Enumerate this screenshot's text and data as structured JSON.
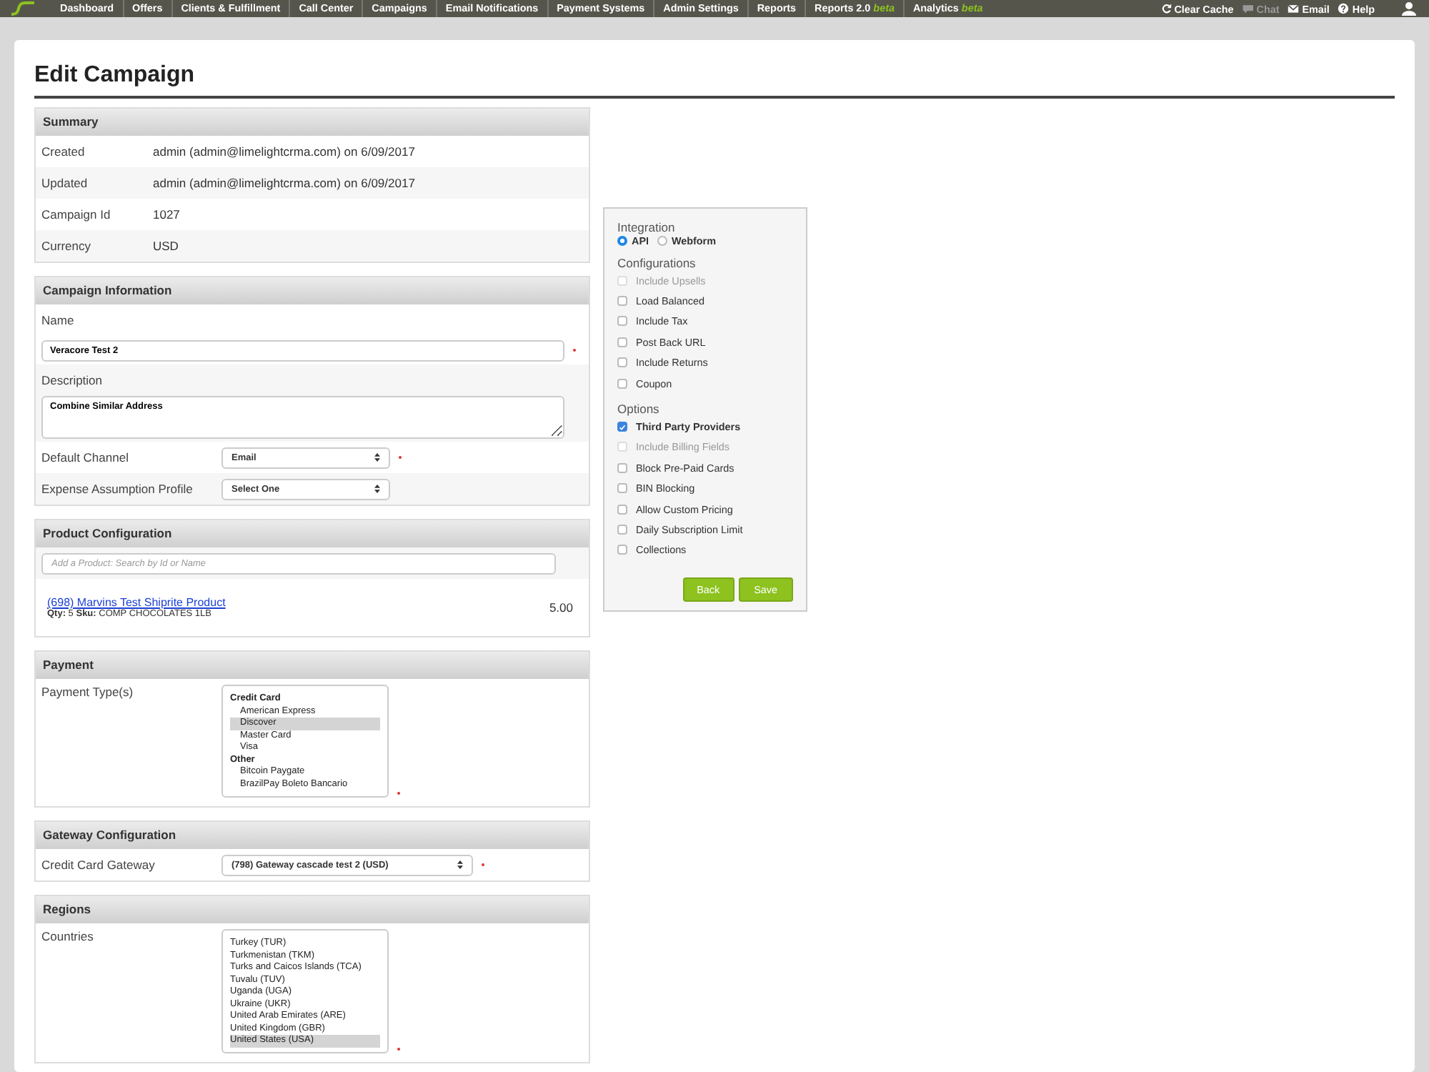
{
  "nav": {
    "items": [
      {
        "label": "Dashboard"
      },
      {
        "label": "Offers"
      },
      {
        "label": "Clients & Fulfillment"
      },
      {
        "label": "Call Center"
      },
      {
        "label": "Campaigns"
      },
      {
        "label": "Email Notifications"
      },
      {
        "label": "Payment Systems"
      },
      {
        "label": "Admin Settings"
      },
      {
        "label": "Reports"
      },
      {
        "label": "Reports 2.0",
        "tag": "beta"
      },
      {
        "label": "Analytics",
        "tag": "beta"
      }
    ],
    "tools": [
      {
        "label": "Clear Cache",
        "kind": "refresh",
        "disabled": false
      },
      {
        "label": "Chat",
        "kind": "chat",
        "disabled": true
      },
      {
        "label": "Email",
        "kind": "mail",
        "disabled": false
      },
      {
        "label": "Help",
        "kind": "help",
        "disabled": false
      }
    ]
  },
  "page_title": "Edit Campaign",
  "sections": [
    {
      "title": "Summary",
      "rows": [
        {
          "kind": "info",
          "label": "Created",
          "value": "admin (admin@limelightcrma.com) on 6/09/2017"
        },
        {
          "kind": "info",
          "label": "Updated",
          "value": "admin (admin@limelightcrma.com) on 6/09/2017"
        },
        {
          "kind": "info",
          "label": "Campaign Id",
          "value": "1027"
        },
        {
          "kind": "info",
          "label": "Currency",
          "value": "USD"
        }
      ]
    },
    {
      "title": "Campaign Information",
      "rows": [
        {
          "kind": "input",
          "label": "Name",
          "value": "Veracore Test 2",
          "required": true
        },
        {
          "kind": "textarea",
          "label": "Description",
          "value": "Combine Similar Address",
          "required": false
        },
        {
          "kind": "select",
          "label": "Default Channel",
          "value": "Email",
          "required": true
        },
        {
          "kind": "select",
          "label": "Expense Assumption Profile",
          "value": "Select One",
          "required": false
        }
      ]
    },
    {
      "title": "Product Configuration",
      "rows": [
        {
          "kind": "search",
          "placeholder": "Add a Product: Search by Id or Name"
        },
        {
          "kind": "product",
          "link": "(698) Marvins Test Shiprite Product",
          "detail": "**Qty:** 5 **Sku:** COMP CHOCOLATES 1LB",
          "price": "5.00"
        }
      ]
    },
    {
      "title": "Payment",
      "rows": [
        {
          "kind": "listbox",
          "label": "Payment Type(s)",
          "required": true,
          "options": [
            {
              "kind": "group",
              "label": "Credit Card"
            },
            {
              "kind": "option",
              "label": "American Express",
              "selected": false
            },
            {
              "kind": "option",
              "label": "Discover",
              "selected": true
            },
            {
              "kind": "option",
              "label": "Master Card",
              "selected": false
            },
            {
              "kind": "option",
              "label": "Visa",
              "selected": false
            },
            {
              "kind": "group",
              "label": "Other"
            },
            {
              "kind": "option",
              "label": "Bitcoin Paygate",
              "selected": false
            },
            {
              "kind": "option",
              "label": "BrazilPay Boleto Bancario",
              "selected": false
            }
          ]
        }
      ]
    },
    {
      "title": "Gateway Configuration",
      "rows": [
        {
          "kind": "select",
          "label": "Credit Card Gateway",
          "value": "(798) Gateway cascade test 2 (USD)",
          "required": true
        }
      ]
    },
    {
      "title": "Regions",
      "rows": [
        {
          "kind": "listbox",
          "label": "Countries",
          "required": true,
          "options": [
            {
              "kind": "option",
              "label": "Turkey (TUR)",
              "selected": false
            },
            {
              "kind": "option",
              "label": "Turkmenistan (TKM)",
              "selected": false
            },
            {
              "kind": "option",
              "label": "Turks and Caicos Islands (TCA)",
              "selected": false
            },
            {
              "kind": "option",
              "label": "Tuvalu (TUV)",
              "selected": false
            },
            {
              "kind": "option",
              "label": "Uganda (UGA)",
              "selected": false
            },
            {
              "kind": "option",
              "label": "Ukraine (UKR)",
              "selected": false
            },
            {
              "kind": "option",
              "label": "United Arab Emirates (ARE)",
              "selected": false
            },
            {
              "kind": "option",
              "label": "United Kingdom (GBR)",
              "selected": false
            },
            {
              "kind": "option",
              "label": "United States (USA)",
              "selected": true
            }
          ]
        }
      ]
    }
  ],
  "side": {
    "integration": {
      "title": "Integration",
      "options": [
        {
          "label": "API",
          "selected": true
        },
        {
          "label": "Webform",
          "selected": false
        }
      ]
    },
    "groups": [
      {
        "title": "Configurations",
        "items": [
          {
            "label": "Include Upsells",
            "checked": false,
            "disabled": true
          },
          {
            "label": "Load Balanced",
            "checked": false,
            "disabled": false
          },
          {
            "label": "Include Tax",
            "checked": false,
            "disabled": false
          },
          {
            "label": "Post Back URL",
            "checked": false,
            "disabled": false
          },
          {
            "label": "Include Returns",
            "checked": false,
            "disabled": false
          },
          {
            "label": "Coupon",
            "checked": false,
            "disabled": false
          }
        ]
      },
      {
        "title": "Options",
        "items": [
          {
            "label": "Third Party Providers",
            "checked": true,
            "disabled": false
          },
          {
            "label": "Include Billing Fields",
            "checked": false,
            "disabled": true
          },
          {
            "label": "Block Pre-Paid Cards",
            "checked": false,
            "disabled": false
          },
          {
            "label": "BIN Blocking",
            "checked": false,
            "disabled": false
          },
          {
            "label": "Allow Custom Pricing",
            "checked": false,
            "disabled": false
          },
          {
            "label": "Daily Subscription Limit",
            "checked": false,
            "disabled": false
          },
          {
            "label": "Collections",
            "checked": false,
            "disabled": false
          }
        ]
      }
    ],
    "buttons": [
      "Back",
      "Save"
    ]
  }
}
